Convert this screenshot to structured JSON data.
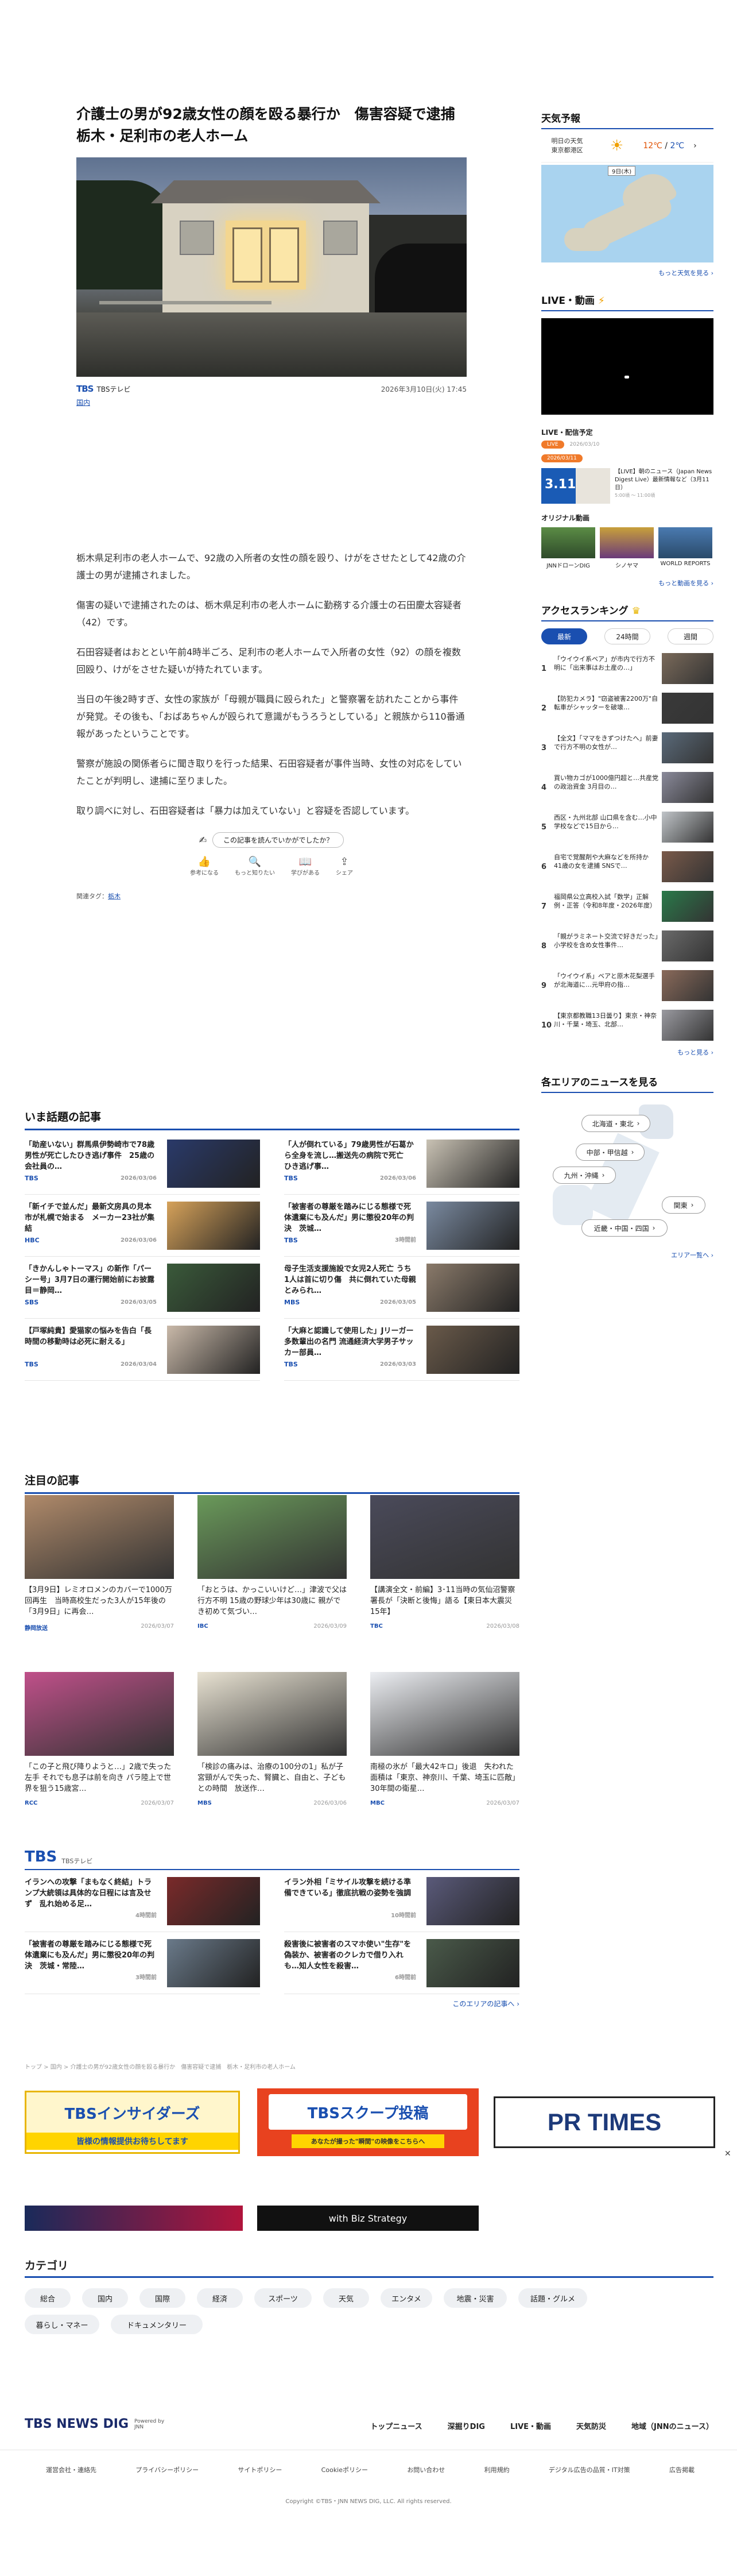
{
  "article": {
    "title": "介護士の男が92歳女性の顔を殴る暴行か　傷害容疑で逮捕　栃木・足利市の老人ホーム",
    "source": "TBSテレビ",
    "source_logo": "TBS",
    "category": "国内",
    "datetime": "2026年3月10日(火) 17:45",
    "paragraphs": [
      "栃木県足利市の老人ホームで、92歳の入所者の女性の顔を殴り、けがをさせたとして42歳の介護士の男が逮捕されました。",
      "傷害の疑いで逮捕されたのは、栃木県足利市の老人ホームに勤務する介護士の石田慶太容疑者（42）です。",
      "石田容疑者はおととい午前4時半ごろ、足利市の老人ホームで入所者の女性（92）の顔を複数回殴り、けがをさせた疑いが持たれています。",
      "当日の午後2時すぎ、女性の家族が「母親が職員に殴られた」と警察署を訪れたことから事件が発覚。その後も、「おばあちゃんが殴られて意識がもうろうとしている」と親族から110番通報があったということです。",
      "警察が施設の関係者らに聞き取りを行った結果、石田容疑者が事件当時、女性の対応をしていたことが判明し、逮捕に至りました。",
      "取り調べに対し、石田容疑者は「暴力は加えていない」と容疑を否認しています。"
    ],
    "feedback_prompt": "この記事を読んでいかがでしたか？",
    "reactions": [
      "参考になる",
      "もっと知りたい",
      "学びがある",
      "シェア"
    ],
    "tags_label": "関連タグ：",
    "tag": "栃木"
  },
  "trending": {
    "title": "いま話題の記事",
    "items": [
      {
        "text": "「助産いない」群馬県伊勢崎市で78歳男性が死亡したひき逃げ事件　25歳の会社員の…",
        "logo": "TBS",
        "date": "2026/03/06"
      },
      {
        "text": "「人が倒れている」79歳男性が石葛から全身を流し…搬送先の病院で死亡　ひき逃げ事…",
        "logo": "TBS",
        "date": "2026/03/06"
      },
      {
        "text": "「新イチで並んだ」最新文房具の見本市が札幌で始まる　メーカー23社が集結",
        "logo": "HBC",
        "date": "2026/03/06"
      },
      {
        "text": "「被害者の尊厳を踏みにじる態様で死体遺棄にも及んだ」男に懲役20年の判決　茨城…",
        "logo": "TBS",
        "date": "3時間前"
      },
      {
        "text": "「きかんしゃトーマス」の新作「パーシー号」3月7日の運行開始前にお披露目＝静岡…",
        "logo": "SBS",
        "date": "2026/03/05"
      },
      {
        "text": "母子生活支援施設で女児2人死亡 うち1人は首に切り傷　共に倒れていた母親とみられ…",
        "logo": "MBS",
        "date": "2026/03/05"
      },
      {
        "text": "【戸塚純貴】愛猫家の悩みを告白「長時間の移動時は必死に耐える」",
        "logo": "TBS",
        "date": "2026/03/04"
      },
      {
        "text": "「大麻と認識して使用した」Jリーガー多数輩出の名門 流通経済大学男子サッカー部員…",
        "logo": "TBS",
        "date": "2026/03/03"
      }
    ]
  },
  "featured": {
    "title": "注目の記事",
    "items": [
      {
        "text": "【3月9日】レミオロメンのカバーで1000万回再生　当時高校生だった3人が15年後の「3月9日」に再会…",
        "logo": "静岡放送",
        "date": "2026/03/07"
      },
      {
        "text": "「おとうは、かっこいいけど…」津波で父は行方不明 15歳の野球少年は30歳に 親ができ初めて気づい…",
        "logo": "IBC",
        "date": "2026/03/09"
      },
      {
        "text": "【講演全文・前編】3･11当時の気仙沼警察署長が「決断と後悔」語る【東日本大震災15年】",
        "logo": "TBC",
        "date": "2026/03/08"
      },
      {
        "text": "「この子と飛び降りようと…」2歳で失った左手 それでも息子は前を向き パラ陸上で世界を狙う15歳宮…",
        "logo": "RCC",
        "date": "2026/03/07"
      },
      {
        "text": "「検診の痛みは、治療の100分の1」私が子宮頸がんで失った、腎臓と、自由と、子どもとの時間　放送作…",
        "logo": "MBS",
        "date": "2026/03/06"
      },
      {
        "text": "南極の氷が「最大42キロ」後退　失われた面積は「東京、神奈川、千葉、埼玉に匹敵」30年間の衛星…",
        "logo": "MBC",
        "date": "2026/03/07"
      }
    ]
  },
  "tbs_section": {
    "logo": "TBS",
    "sub": "TBSテレビ",
    "items": [
      {
        "text": "イランへの攻撃「まもなく終結」トランプ大統領は具体的な日程には言及せず　乱れ始める足…",
        "date": "4時間前"
      },
      {
        "text": "イラン外相「ミサイル攻撃を続ける準備できている」徹底抗戦の姿勢を強調",
        "date": "10時間前"
      },
      {
        "text": "「被害者の尊厳を踏みにじる態様で死体遺棄にも及んだ」男に懲役20年の判決　茨城・常陸…",
        "date": "3時間前"
      },
      {
        "text": "殺害後に被害者のスマホ使い\"生存\"を偽装か、被害者のクレカで借り入れも…知人女性を殺害…",
        "date": "6時間前"
      }
    ],
    "more": "このエリアの記事へ"
  },
  "breadcrumb": "トップ > 国内 > 介護士の男が92歳女性の顔を殴る暴行か　傷害容疑で逮捕　栃木・足利市の老人ホーム",
  "banners": {
    "insider_title": "TBSインサイダーズ",
    "insider_sub": "皆様の情報提供お待ちしてます",
    "scoop_title": "TBSスクープ投稿",
    "scoop_sub": "あなたが撮った\"瞬間\"の映像をこちらへ",
    "prtimes": "PR TIMES",
    "video_text": "with Biz Strategy"
  },
  "categories": {
    "title": "カテゴリ",
    "items": [
      "総合",
      "国内",
      "国際",
      "経済",
      "スポーツ",
      "天気",
      "エンタメ",
      "地震・災害",
      "話題・グルメ",
      "暮らし・マネー",
      "ドキュメンタリー"
    ]
  },
  "footer": {
    "logo": "TBS NEWS DIG",
    "powered": "Powered by JNN",
    "nav": [
      "トップニュース",
      "深掘りDIG",
      "LIVE・動画",
      "天気防災",
      "地域（JNNのニュース）"
    ],
    "links": [
      "運営会社・連絡先",
      "プライバシーポリシー",
      "サイトポリシー",
      "Cookieポリシー",
      "お問い合わせ",
      "利用規約",
      "デジタル広告の品質・IT対策",
      "広告掲載"
    ],
    "copyright": "Copyright ©TBS・JNN NEWS DIG, LLC. All rights reserved."
  },
  "weather": {
    "title": "天気予報",
    "label": "明日の天気",
    "place": "東京都港区",
    "temp_high": "12℃",
    "temp_low": "2℃",
    "map_date": "9日(木)",
    "more": "もっと天気を見る"
  },
  "live": {
    "title": "LIVE・動画",
    "schedule_title": "LIVE・配信予定",
    "badge1": "LIVE",
    "date1": "2026/03/10",
    "badge2": "2026/03/11",
    "date_label": "3.11",
    "item": "【LIVE】朝のニュース（Japan News Digest Live）最新情報など（3月11日）",
    "item_time": "5:00頃 ～ 11:00頃"
  },
  "original": {
    "title": "オリジナル動画",
    "items": [
      "JNNドローンDIG",
      "シノヤマ",
      "WORLD REPORTS"
    ],
    "more": "もっと動画を見る"
  },
  "ranking": {
    "title": "アクセスランキング",
    "tabs": [
      "最新",
      "24時間",
      "週間"
    ],
    "items": [
      "「ウイウイ系ベア」が市内で行方不明に「出来事はお土産の…」",
      "【防犯カメラ】\"窃盗被害2200万\"自転車がシャッターを破壊…",
      "【全文】「ママをきずつけたへ」前妻で行方不明の女性が…",
      "買い物カゴが1000億円超と…共産党の政治資金 3月目の…",
      "西区・九州北部 山口県を含む…小中学校などで15日から…",
      "自宅で覚醒剤や大麻などを所持か 41歳の女を逮捕 SNSで…",
      "福岡県公立高校入試「数学」正解例・正答（令和8年度・2026年度）",
      "「親がラミネート交流で好きだった」小学校を含め女性事件…",
      "「ウイウイ系」ベアと原木花梨選手が北海道に…元甲府の指…",
      "【東京都教職13日曇り】東京・神奈川・千葉・埼玉、北部…"
    ],
    "more": "もっと見る"
  },
  "area": {
    "title": "各エリアのニュースを見る",
    "pills": [
      "北海道・東北",
      "中部・甲信越",
      "九州・沖縄",
      "関東",
      "近畿・中国・四国"
    ],
    "more": "エリア一覧へ"
  }
}
